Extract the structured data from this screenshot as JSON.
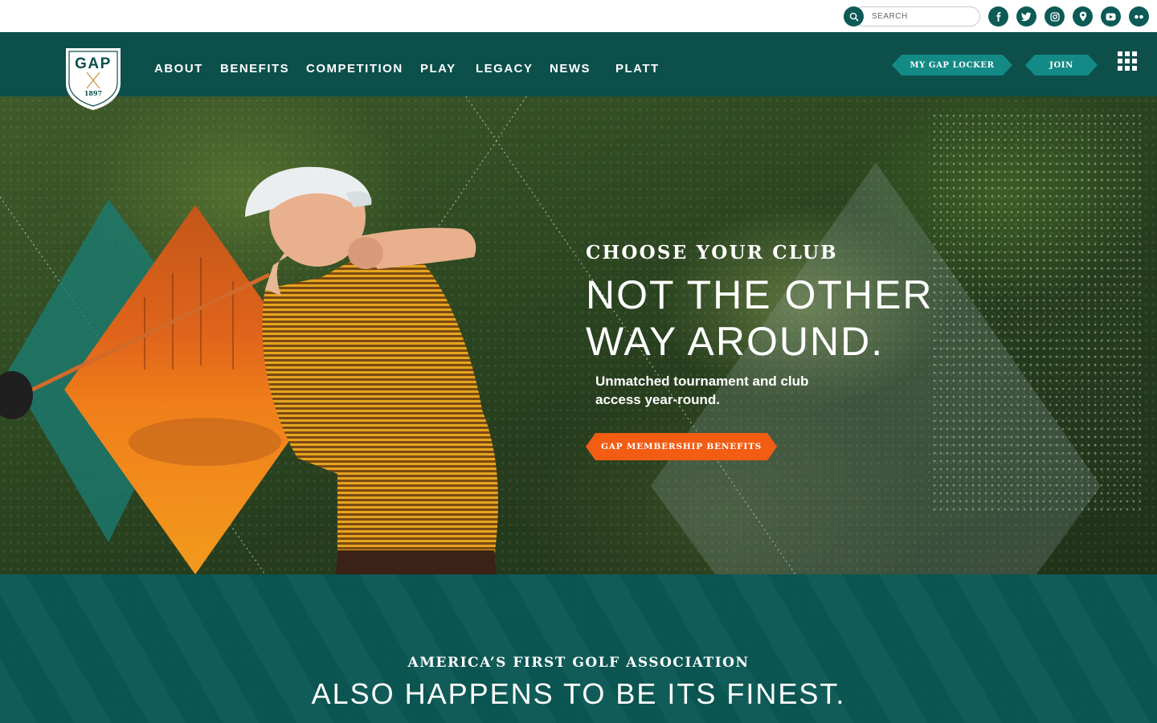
{
  "brand": {
    "name": "GAP",
    "year": "1897",
    "primary_color": "#0c4f4b",
    "accent_color": "#138a86",
    "cta_color": "#f25c13"
  },
  "utility": {
    "search_placeholder": "SEARCH",
    "social_icons": [
      "facebook-icon",
      "twitter-icon",
      "instagram-icon",
      "location-pin-icon",
      "youtube-icon",
      "flickr-icon"
    ]
  },
  "nav": {
    "items": [
      "ABOUT",
      "BENEFITS",
      "COMPETITION",
      "PLAY",
      "LEGACY",
      "NEWS",
      "PLATT"
    ],
    "locker_label": "MY GAP LOCKER",
    "join_label": "JOIN",
    "menu_icon": "grid-menu-icon"
  },
  "hero": {
    "eyebrow": "CHOOSE YOUR CLUB",
    "headline_line1": "NOT THE OTHER",
    "headline_line2": "WAY AROUND.",
    "subhead": "Unmatched tournament and club access year-round.",
    "cta_label": "GAP MEMBERSHIP BENEFITS"
  },
  "band": {
    "eyebrow": "AMERICA’S FIRST GOLF ASSOCIATION",
    "title": "ALSO HAPPENS TO BE ITS FINEST."
  }
}
